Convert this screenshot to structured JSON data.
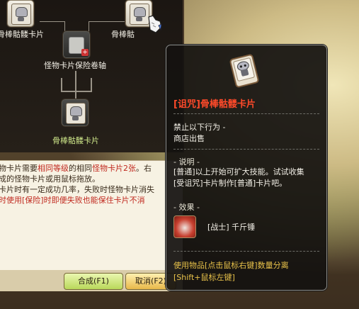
{
  "combine_panel": {
    "top_left_card_label": "骨棒骷髅卡片",
    "top_right_card_label": "骨棒骷",
    "scroll_label": "怪物卡片保险卷轴",
    "result_card_label": "骨棒骷髅卡片"
  },
  "description": {
    "lines": [
      {
        "parts": [
          {
            "t": "物卡片需要",
            "c": "normal"
          },
          {
            "t": "相同等级",
            "c": "red"
          },
          {
            "t": "的相同",
            "c": "normal"
          },
          {
            "t": "怪物卡片2张",
            "c": "red"
          },
          {
            "t": "。右",
            "c": "normal"
          }
        ]
      },
      {
        "parts": [
          {
            "t": "成的怪物卡片或用鼠标拖放。",
            "c": "normal"
          }
        ]
      },
      {
        "parts": [
          {
            "t": "卡片时有一定成功几率，失败时怪物卡片消失",
            "c": "normal"
          }
        ]
      },
      {
        "parts": [
          {
            "t": "时使用[保险]时即便失败也能保住卡片不消",
            "c": "normal"
          }
        ]
      }
    ]
  },
  "buttons": {
    "ok_label": "合成(F1)",
    "cancel_label": "取消(F2)"
  },
  "tooltip": {
    "title": "[诅咒]骨棒骷髅卡片",
    "restrictions_heading": "禁止以下行为 -",
    "restriction_1": "商店出售",
    "desc_heading": "- 说明 -",
    "desc_line_1": "[普通]以上开始可扩大技能。试试收集",
    "desc_line_2": "[受诅咒]卡片制作[普通]卡片吧。",
    "effect_heading": "- 效果 -",
    "effect_skill": "[战士] 千斤锤",
    "footer": "使用物品[点击鼠标右键]数量分离[Shift+鼠标左键]"
  },
  "icons": {
    "card": "skeleton-card-icon",
    "scroll": "insurance-scroll-icon",
    "skill": "heavy-hammer-skill-icon",
    "cursor": "glove-cursor-icon"
  },
  "colors": {
    "tooltip_title": "#ff4a2a",
    "footer_text": "#e8c24a",
    "highlight_red": "#c0291f"
  }
}
